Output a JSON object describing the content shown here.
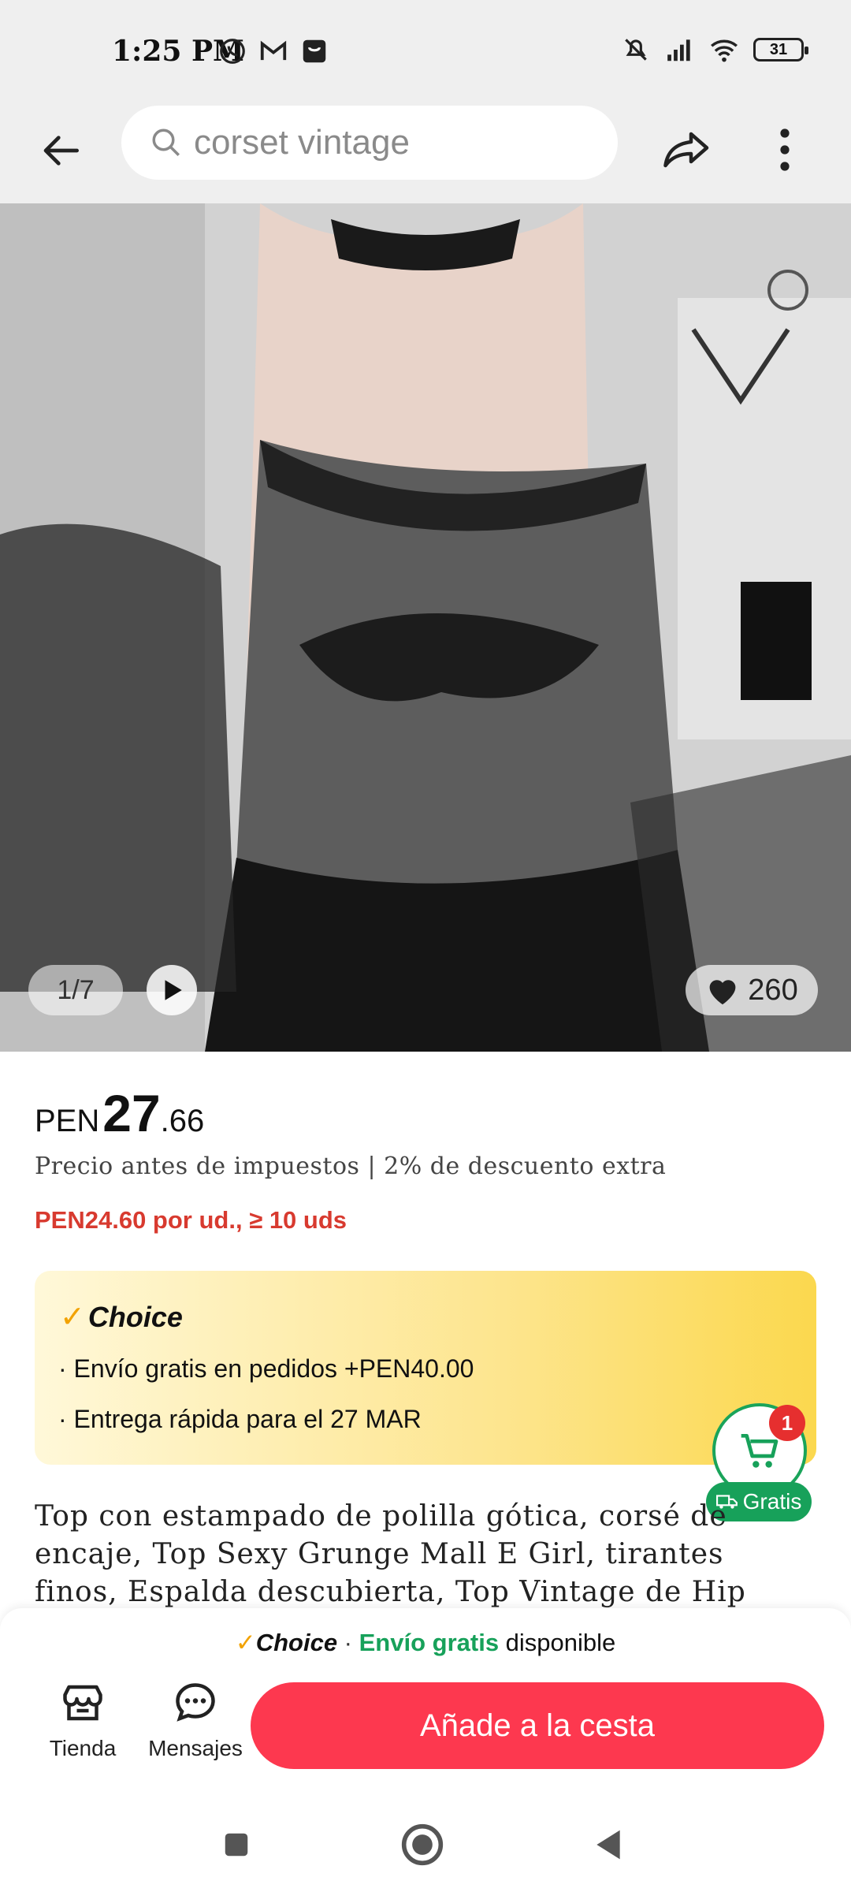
{
  "status_bar": {
    "time": "1:25 PM",
    "battery": "31"
  },
  "top_nav": {
    "search_placeholder": "corset vintage"
  },
  "gallery": {
    "counter": "1/7",
    "likes": "260"
  },
  "price": {
    "currency": "PEN",
    "integer": "27",
    "decimal": ".66",
    "tax_note": "Precio antes de impuestos | 2% de descuento extra",
    "bulk_price": "PEN24.60 por ud., ≥ 10 uds"
  },
  "choice_box": {
    "check": "✓",
    "title": "Choice",
    "line1": "· Envío gratis en pedidos +PEN40.00",
    "line2": "· Entrega rápida para el 27 MAR"
  },
  "floating_cart": {
    "badge": "1",
    "gratis": "Gratis"
  },
  "product_title": "Top con estampado de polilla gótica, corsé de encaje, Top Sexy Grunge Mall E Girl, tirantes finos, Espalda descubierta, Top Vintage de Hip Hop",
  "bottom_bar": {
    "banner_check": "✓",
    "banner_choice": "Choice",
    "banner_sep": " · ",
    "banner_green": "Envío gratis",
    "banner_rest": " disponible",
    "tienda": "Tienda",
    "mensajes": "Mensajes",
    "add_to_cart": "Añade a la cesta"
  },
  "colors": {
    "accent_red": "#fd384f",
    "green": "#17a15a",
    "bulk_red": "#d83a2f",
    "choice_yellow": "#fbd84e"
  }
}
